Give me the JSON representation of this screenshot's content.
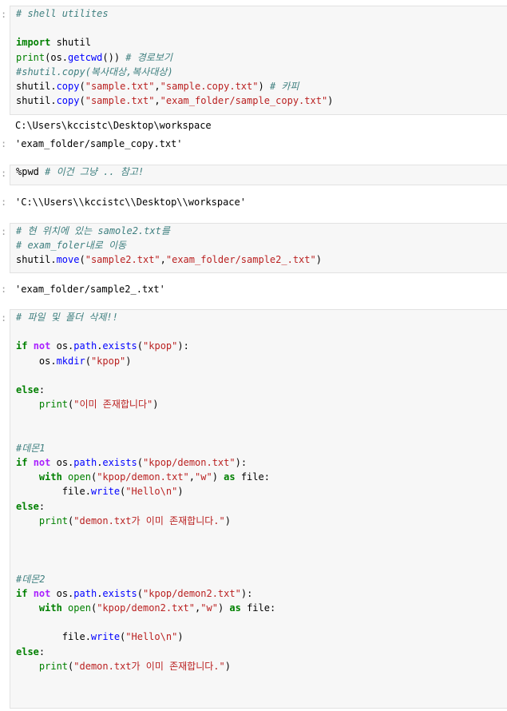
{
  "cells": [
    {
      "id": "shell-utils",
      "prompt": ":",
      "lines": [
        [
          [
            "c",
            "# shell utilites"
          ]
        ],
        [],
        [
          [
            "k",
            "import"
          ],
          [
            "m",
            " shutil"
          ]
        ],
        [
          [
            "b",
            "print"
          ],
          [
            "m",
            "(os."
          ],
          [
            "f",
            "getcwd"
          ],
          [
            "m",
            "()) "
          ],
          [
            "c",
            "# 경로보기"
          ]
        ],
        [
          [
            "c",
            "#shutil.copy(복사대상,복사대상)"
          ]
        ],
        [
          [
            "m",
            "shutil."
          ],
          [
            "f",
            "copy"
          ],
          [
            "m",
            "("
          ],
          [
            "s",
            "\"sample.txt\""
          ],
          [
            "m",
            ","
          ],
          [
            "s",
            "\"sample.copy.txt\""
          ],
          [
            "m",
            ") "
          ],
          [
            "c",
            "# 카피"
          ]
        ],
        [
          [
            "m",
            "shutil."
          ],
          [
            "f",
            "copy"
          ],
          [
            "m",
            "("
          ],
          [
            "s",
            "\"sample.txt\""
          ],
          [
            "m",
            ","
          ],
          [
            "s",
            "\"exam_folder/sample_copy.txt\""
          ],
          [
            "m",
            ")"
          ]
        ]
      ],
      "outputs": [
        {
          "prompt": "",
          "text": "C:\\Users\\kccistc\\Desktop\\workspace"
        },
        {
          "prompt": ":",
          "text": "'exam_folder/sample_copy.txt'"
        }
      ]
    },
    {
      "id": "pwd",
      "prompt": ":",
      "lines": [
        [
          [
            "m",
            "%pwd "
          ],
          [
            "c",
            "# 이건 그냥 .. 참고!"
          ]
        ]
      ],
      "outputs": [
        {
          "prompt": ":",
          "text": "'C:\\\\Users\\\\kccistc\\\\Desktop\\\\workspace'"
        }
      ]
    },
    {
      "id": "move",
      "prompt": ":",
      "lines": [
        [
          [
            "c",
            "# 현 위치에 있는 samole2.txt를"
          ]
        ],
        [
          [
            "c",
            "# exam_foler내로 이동"
          ]
        ],
        [
          [
            "m",
            "shutil."
          ],
          [
            "f",
            "move"
          ],
          [
            "m",
            "("
          ],
          [
            "s",
            "\"sample2.txt\""
          ],
          [
            "m",
            ","
          ],
          [
            "s",
            "\"exam_folder/sample2_.txt\""
          ],
          [
            "m",
            ")"
          ]
        ]
      ],
      "outputs": [
        {
          "prompt": ":",
          "text": "'exam_folder/sample2_.txt'"
        }
      ]
    },
    {
      "id": "delete",
      "prompt": ":",
      "lines": [
        [
          [
            "c",
            "# 파일 및 폴더 삭제!!"
          ]
        ],
        [],
        [
          [
            "k",
            "if"
          ],
          [
            "m",
            " "
          ],
          [
            "o",
            "not"
          ],
          [
            "m",
            " os."
          ],
          [
            "f",
            "path"
          ],
          [
            "m",
            "."
          ],
          [
            "f",
            "exists"
          ],
          [
            "m",
            "("
          ],
          [
            "s",
            "\"kpop\""
          ],
          [
            "m",
            "):"
          ]
        ],
        [
          [
            "m",
            "    os."
          ],
          [
            "f",
            "mkdir"
          ],
          [
            "m",
            "("
          ],
          [
            "s",
            "\"kpop\""
          ],
          [
            "m",
            ")"
          ]
        ],
        [],
        [
          [
            "k",
            "else"
          ],
          [
            "m",
            ":"
          ]
        ],
        [
          [
            "m",
            "    "
          ],
          [
            "b",
            "print"
          ],
          [
            "m",
            "("
          ],
          [
            "s",
            "\"이미 존재합니다\""
          ],
          [
            "m",
            ")"
          ]
        ],
        [],
        [],
        [
          [
            "c",
            "#데몬1"
          ]
        ],
        [
          [
            "k",
            "if"
          ],
          [
            "m",
            " "
          ],
          [
            "o",
            "not"
          ],
          [
            "m",
            " os."
          ],
          [
            "f",
            "path"
          ],
          [
            "m",
            "."
          ],
          [
            "f",
            "exists"
          ],
          [
            "m",
            "("
          ],
          [
            "s",
            "\"kpop/demon.txt\""
          ],
          [
            "m",
            "):"
          ]
        ],
        [
          [
            "m",
            "    "
          ],
          [
            "k",
            "with"
          ],
          [
            "m",
            " "
          ],
          [
            "b",
            "open"
          ],
          [
            "m",
            "("
          ],
          [
            "s",
            "\"kpop/demon.txt\""
          ],
          [
            "m",
            ","
          ],
          [
            "s",
            "\"w\""
          ],
          [
            "m",
            ") "
          ],
          [
            "k",
            "as"
          ],
          [
            "m",
            " file:"
          ]
        ],
        [
          [
            "m",
            "        file."
          ],
          [
            "f",
            "write"
          ],
          [
            "m",
            "("
          ],
          [
            "s",
            "\"Hello\\n\""
          ],
          [
            "m",
            ")"
          ]
        ],
        [
          [
            "k",
            "else"
          ],
          [
            "m",
            ":"
          ]
        ],
        [
          [
            "m",
            "    "
          ],
          [
            "b",
            "print"
          ],
          [
            "m",
            "("
          ],
          [
            "s",
            "\"demon.txt가 이미 존재합니다.\""
          ],
          [
            "m",
            ")"
          ]
        ],
        [],
        [],
        [],
        [
          [
            "c",
            "#데몬2"
          ]
        ],
        [
          [
            "k",
            "if"
          ],
          [
            "m",
            " "
          ],
          [
            "o",
            "not"
          ],
          [
            "m",
            " os."
          ],
          [
            "f",
            "path"
          ],
          [
            "m",
            "."
          ],
          [
            "f",
            "exists"
          ],
          [
            "m",
            "("
          ],
          [
            "s",
            "\"kpop/demon2.txt\""
          ],
          [
            "m",
            "):"
          ]
        ],
        [
          [
            "m",
            "    "
          ],
          [
            "k",
            "with"
          ],
          [
            "m",
            " "
          ],
          [
            "b",
            "open"
          ],
          [
            "m",
            "("
          ],
          [
            "s",
            "\"kpop/demon2.txt\""
          ],
          [
            "m",
            ","
          ],
          [
            "s",
            "\"w\""
          ],
          [
            "m",
            ") "
          ],
          [
            "k",
            "as"
          ],
          [
            "m",
            " file:"
          ]
        ],
        [],
        [
          [
            "m",
            "        file."
          ],
          [
            "f",
            "write"
          ],
          [
            "m",
            "("
          ],
          [
            "s",
            "\"Hello\\n\""
          ],
          [
            "m",
            ")"
          ]
        ],
        [
          [
            "k",
            "else"
          ],
          [
            "m",
            ":"
          ]
        ],
        [
          [
            "m",
            "    "
          ],
          [
            "b",
            "print"
          ],
          [
            "m",
            "("
          ],
          [
            "s",
            "\"demon.txt가 이미 존재합니다.\""
          ],
          [
            "m",
            ")"
          ]
        ]
      ],
      "outputs": []
    }
  ]
}
